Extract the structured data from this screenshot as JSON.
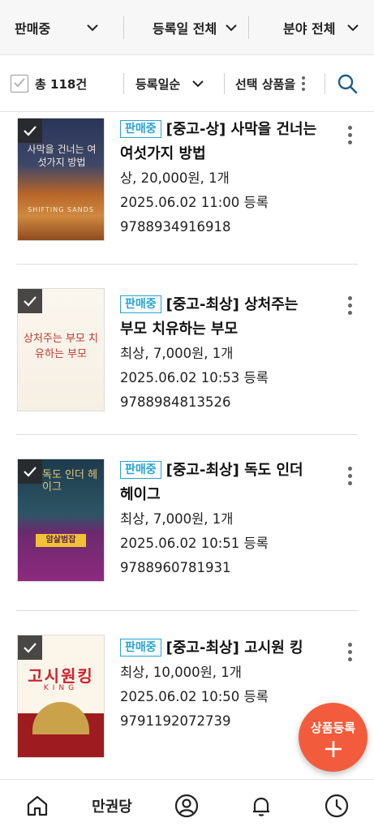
{
  "filters": {
    "status": "판매중",
    "date": "등록일 전체",
    "category": "분야 전체"
  },
  "toolbar": {
    "total": "총 118건",
    "sort": "등록일순",
    "select_label": "선택 상품을"
  },
  "items": [
    {
      "badge": "판매중",
      "title": "[중고-상] 사막을 건너는 여섯가지 방법",
      "condition_price": "상, 20,000원, 1개",
      "registered": "2025.06.02 11:00 등록",
      "isbn": "9788934916918",
      "cover_title": "사막을 건너는 여섯가지 방법",
      "cover_sub": "SHIFTING SANDS"
    },
    {
      "badge": "판매중",
      "title": "[중고-최상] 상처주는 부모 치유하는 부모",
      "condition_price": "최상, 7,000원, 1개",
      "registered": "2025.06.02 10:53 등록",
      "isbn": "9788984813526",
      "cover_title": "상처주는 부모 치유하는 부모"
    },
    {
      "badge": "판매중",
      "title": "[중고-최상] 독도 인더 헤이그",
      "condition_price": "최상, 7,000원, 1개",
      "registered": "2025.06.02 10:51 등록",
      "isbn": "9788960781931",
      "cover_title": "독도 인더 헤이그",
      "cover_band": "암살범잡"
    },
    {
      "badge": "판매중",
      "title": "[중고-최상] 고시원 킹",
      "condition_price": "최상, 10,000원, 1개",
      "registered": "2025.06.02 10:50 등록",
      "isbn": "9791192072739",
      "cover_title": "고시원킹",
      "cover_sub": "KING"
    }
  ],
  "fab": {
    "label": "상품등록"
  },
  "nav": {
    "brand": "만권당"
  },
  "colors": {
    "badge": "#27a3d6",
    "fab": "#f25c3c",
    "search": "#1f5f8b"
  }
}
